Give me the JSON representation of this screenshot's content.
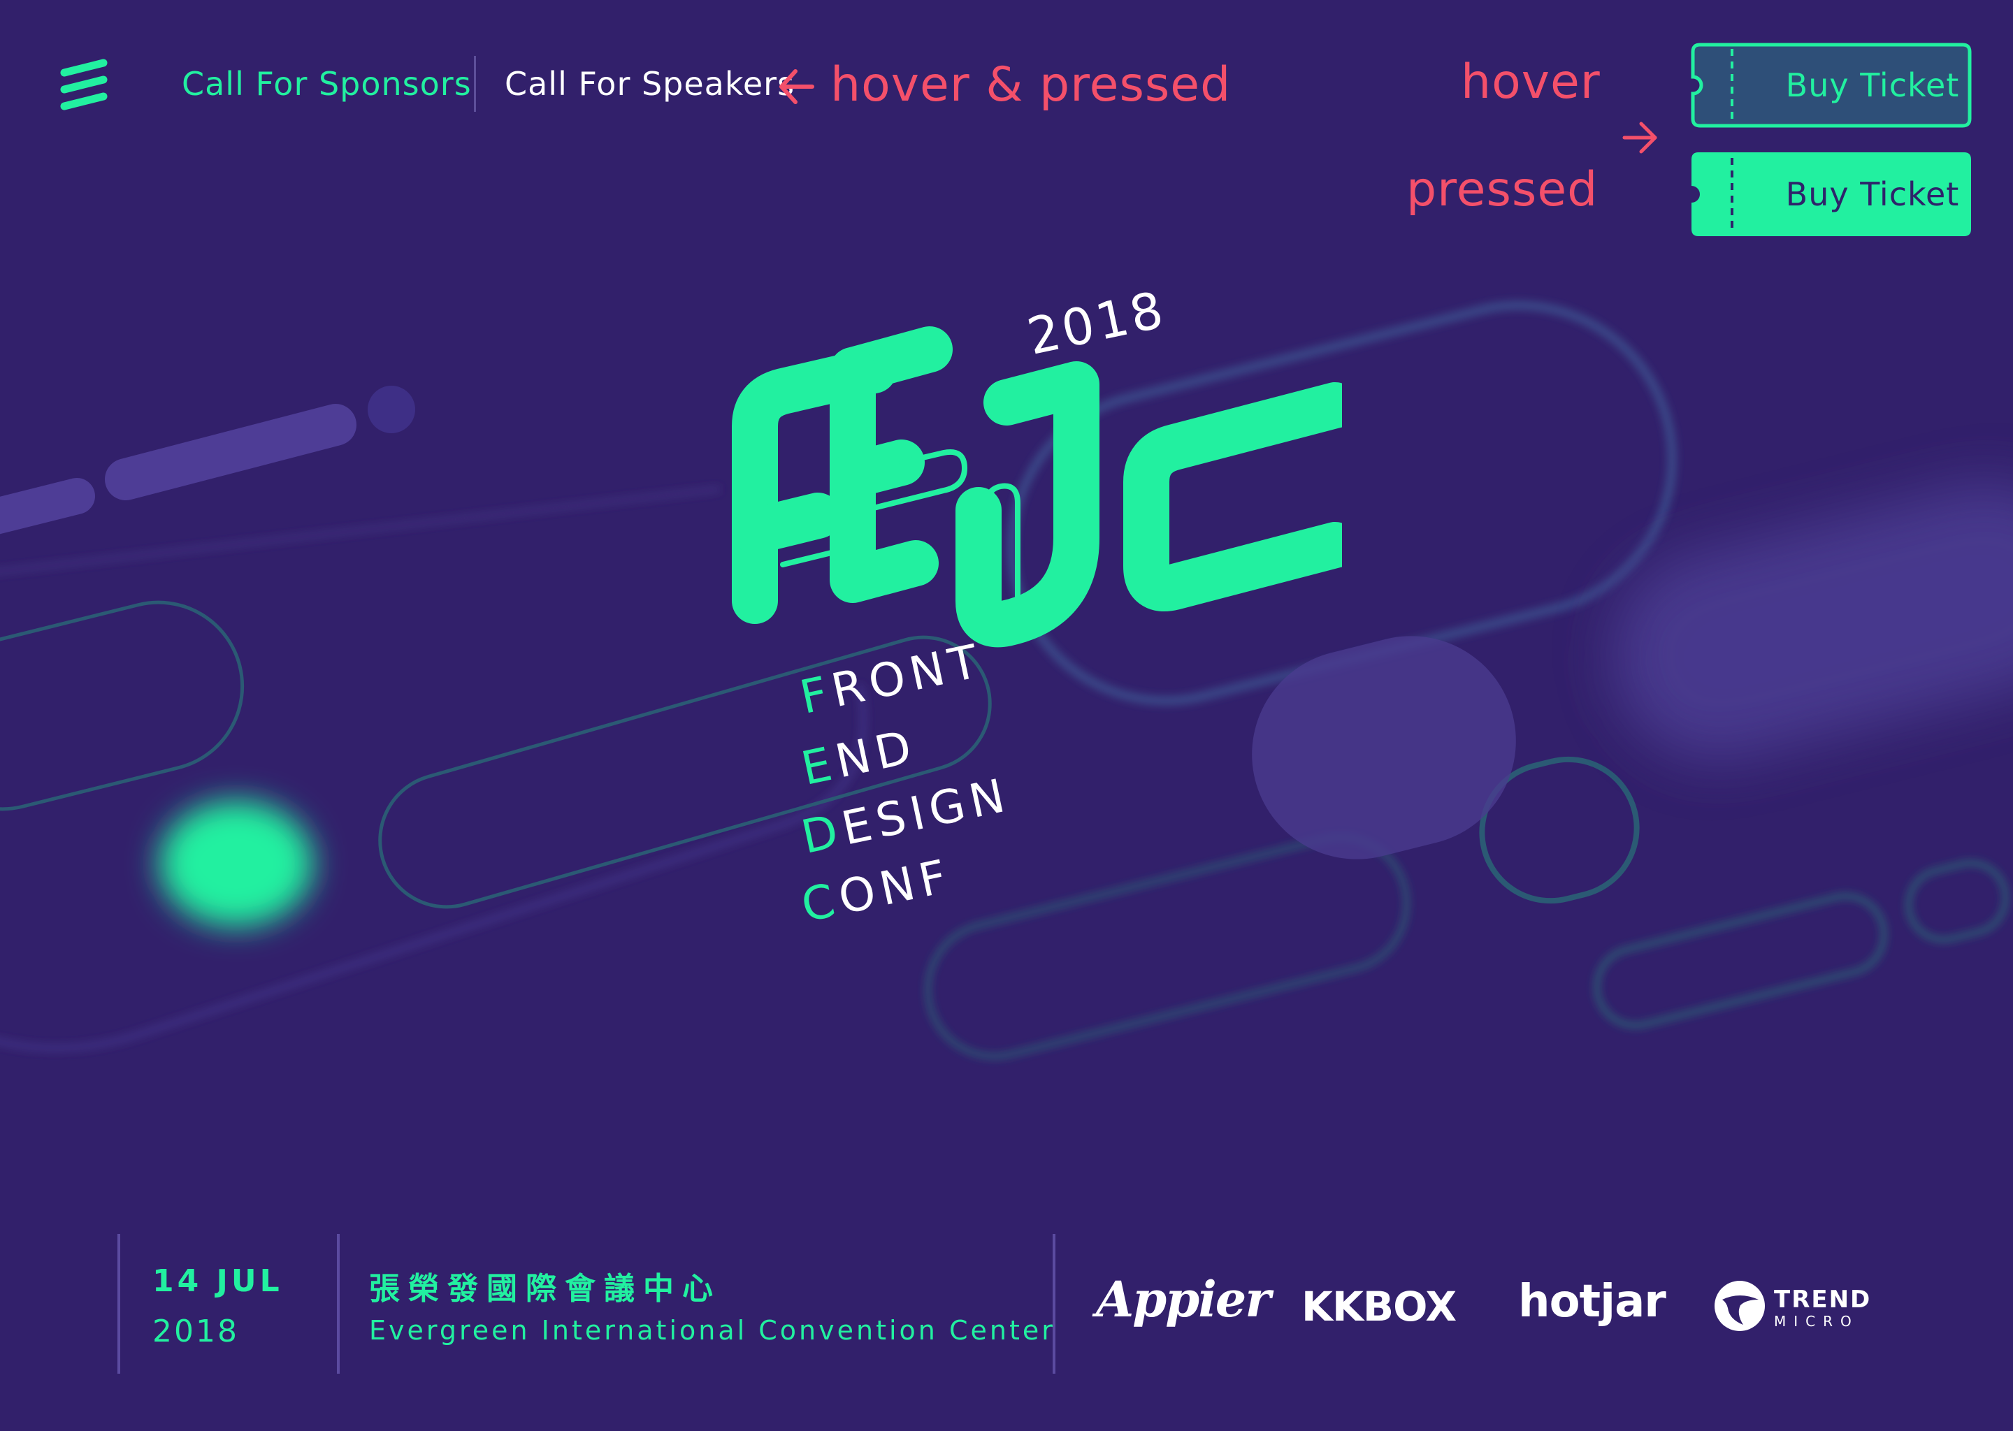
{
  "nav": {
    "sponsors_label": "Call For Sponsors",
    "speakers_label": "Call For Speakers"
  },
  "annotations": {
    "hover_pressed": "hover & pressed",
    "hover": "hover",
    "pressed": "pressed"
  },
  "tickets": {
    "hover_label": "Buy Ticket",
    "pressed_label": "Buy Ticket"
  },
  "hero": {
    "year": "2018",
    "logo_text": "FEDC",
    "tagline": [
      {
        "first": "F",
        "rest": "RONT"
      },
      {
        "first": "E",
        "rest": "ND"
      },
      {
        "first": "D",
        "rest": "ESIGN"
      },
      {
        "first": "C",
        "rest": "ONF"
      }
    ]
  },
  "footer": {
    "date_day": "14 JUL",
    "date_year": "2018",
    "venue_zh": "張榮發國際會議中心",
    "venue_en": "Evergreen International Convention Center"
  },
  "sponsors": {
    "appier": "Appier",
    "kkbox": "KKBOX",
    "hotjar": "hotjar",
    "trend": "TREND",
    "micro": "MICRO"
  },
  "colors": {
    "background": "#32206b",
    "accent": "#22f0a0",
    "annotation": "#f4506a",
    "ticket_text_dark": "#2e236a"
  }
}
